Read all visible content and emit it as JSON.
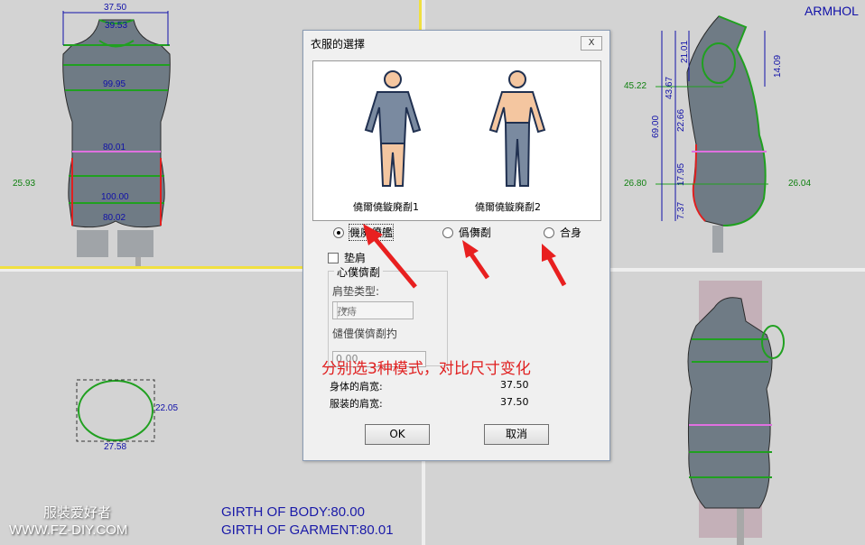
{
  "views": {
    "front": {
      "measurements": {
        "shoulder_width": "37.50",
        "neck": "39.53",
        "chest": "99.95",
        "waist": "80.01",
        "side": "25.93",
        "hip": "100.00",
        "thigh": "80.02"
      }
    },
    "side": {
      "corner_label": "ARMHOL",
      "measurements": {
        "m1": "21.01",
        "m2": "14.09",
        "m3": "43.67",
        "m4": "45.22",
        "m5": "22.66",
        "m6": "69.00",
        "m7": "17.95",
        "m8": "26.80",
        "m9": "26.04",
        "m10": "7.37"
      }
    },
    "armhole": {
      "right_value": "22.05",
      "bottom_value": "27.58"
    },
    "bottom_left": {
      "girth_body_label": "GIRTH OF BODY:80.00",
      "girth_garment_label": "GIRTH OF GARMENT:80.01"
    },
    "watermark": {
      "line1": "服裝爱好者",
      "line2": "WWW.FZ-DIY.COM"
    }
  },
  "dialog": {
    "title": "衣服的選擇",
    "close_label": "X",
    "figure1_caption": "僥爾僥鏇廃劀1",
    "figure2_caption": "僥爾僥鏇廃劀2",
    "radio_options": [
      {
        "label": "僟廃僨艦",
        "selected": true
      },
      {
        "label": "僞儛劀",
        "selected": false
      },
      {
        "label": "合身",
        "selected": false
      }
    ],
    "shoulder_pad_checkbox": "垫肩",
    "group_title": "心僕儕劀",
    "shoulder_pad_type_label": "肩垫类型:",
    "shoulder_pad_type_value": "孜痔",
    "thickness_label": "儙僼僕儕劀扚",
    "thickness_value": "0.00",
    "body_shoulder_label": "身体的肩宽:",
    "body_shoulder_value": "37.50",
    "garment_shoulder_label": "服装的肩宽:",
    "garment_shoulder_value": "37.50",
    "ok_label": "OK",
    "cancel_label": "取消"
  },
  "annotation": "分别选3种模式，对比尺寸变化",
  "colors": {
    "background": "#d3d3d3",
    "measure_blue": "#1010a8",
    "measure_green": "#108010",
    "annotation_red": "#e02020",
    "divider_yellow": "#f0e040"
  }
}
